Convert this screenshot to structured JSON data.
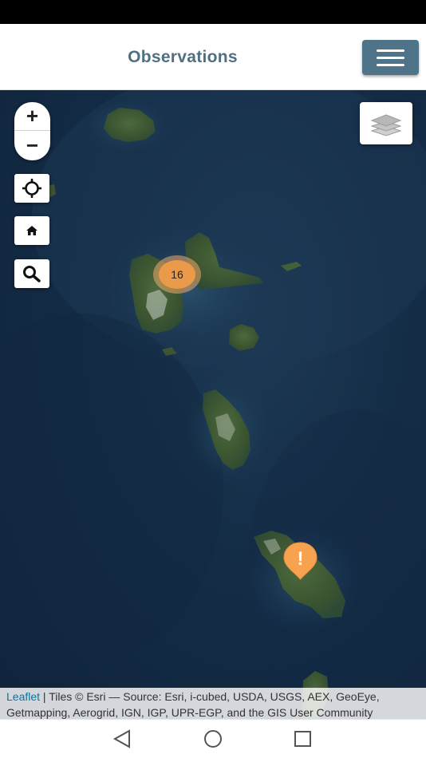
{
  "header": {
    "title": "Observations",
    "menu_icon": "hamburger-menu-icon"
  },
  "map": {
    "basemap": "Esri World Imagery (satellite)",
    "controls": {
      "zoom_in_label": "+",
      "zoom_out_label": "−",
      "locate_icon": "crosshair-icon",
      "home_icon": "home-icon",
      "search_icon": "search-icon",
      "layers_icon": "layers-icon"
    },
    "cluster": {
      "count": "16",
      "color": "#eb9a4a"
    },
    "marker": {
      "symbol": "!",
      "color": "#f7a24e"
    },
    "attribution": {
      "leaflet": "Leaflet",
      "text": " | Tiles © Esri — Source: Esri, i-cubed, USDA, USGS, AEX, GeoEye, Getmapping, Aerogrid, IGN, IGP, UPR-EGP, and the GIS User Community"
    }
  },
  "colors": {
    "header_title": "#4f6f82",
    "menu_button": "#4f7389",
    "link": "#0078a8",
    "ocean": "#142c46",
    "land": "#3f5a34"
  },
  "nav_bar": {
    "back_icon": "back-triangle-icon",
    "home_icon": "home-circle-icon",
    "recent_icon": "recent-square-icon"
  }
}
